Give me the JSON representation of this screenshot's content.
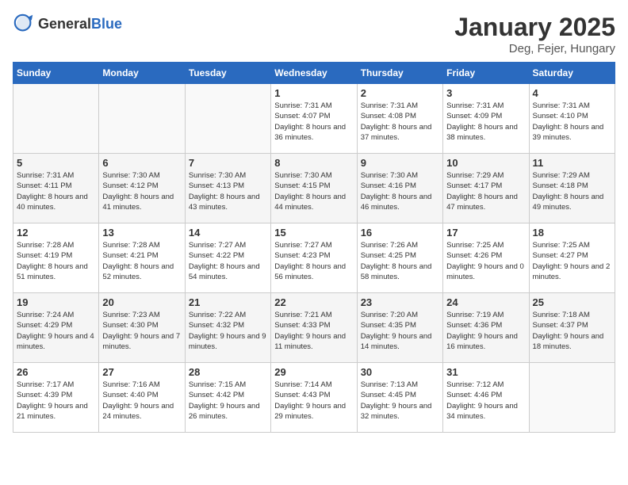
{
  "header": {
    "logo_general": "General",
    "logo_blue": "Blue",
    "month_year": "January 2025",
    "location": "Deg, Fejer, Hungary"
  },
  "days_of_week": [
    "Sunday",
    "Monday",
    "Tuesday",
    "Wednesday",
    "Thursday",
    "Friday",
    "Saturday"
  ],
  "weeks": [
    [
      {
        "day": "",
        "info": ""
      },
      {
        "day": "",
        "info": ""
      },
      {
        "day": "",
        "info": ""
      },
      {
        "day": "1",
        "info": "Sunrise: 7:31 AM\nSunset: 4:07 PM\nDaylight: 8 hours and 36 minutes."
      },
      {
        "day": "2",
        "info": "Sunrise: 7:31 AM\nSunset: 4:08 PM\nDaylight: 8 hours and 37 minutes."
      },
      {
        "day": "3",
        "info": "Sunrise: 7:31 AM\nSunset: 4:09 PM\nDaylight: 8 hours and 38 minutes."
      },
      {
        "day": "4",
        "info": "Sunrise: 7:31 AM\nSunset: 4:10 PM\nDaylight: 8 hours and 39 minutes."
      }
    ],
    [
      {
        "day": "5",
        "info": "Sunrise: 7:31 AM\nSunset: 4:11 PM\nDaylight: 8 hours and 40 minutes."
      },
      {
        "day": "6",
        "info": "Sunrise: 7:30 AM\nSunset: 4:12 PM\nDaylight: 8 hours and 41 minutes."
      },
      {
        "day": "7",
        "info": "Sunrise: 7:30 AM\nSunset: 4:13 PM\nDaylight: 8 hours and 43 minutes."
      },
      {
        "day": "8",
        "info": "Sunrise: 7:30 AM\nSunset: 4:15 PM\nDaylight: 8 hours and 44 minutes."
      },
      {
        "day": "9",
        "info": "Sunrise: 7:30 AM\nSunset: 4:16 PM\nDaylight: 8 hours and 46 minutes."
      },
      {
        "day": "10",
        "info": "Sunrise: 7:29 AM\nSunset: 4:17 PM\nDaylight: 8 hours and 47 minutes."
      },
      {
        "day": "11",
        "info": "Sunrise: 7:29 AM\nSunset: 4:18 PM\nDaylight: 8 hours and 49 minutes."
      }
    ],
    [
      {
        "day": "12",
        "info": "Sunrise: 7:28 AM\nSunset: 4:19 PM\nDaylight: 8 hours and 51 minutes."
      },
      {
        "day": "13",
        "info": "Sunrise: 7:28 AM\nSunset: 4:21 PM\nDaylight: 8 hours and 52 minutes."
      },
      {
        "day": "14",
        "info": "Sunrise: 7:27 AM\nSunset: 4:22 PM\nDaylight: 8 hours and 54 minutes."
      },
      {
        "day": "15",
        "info": "Sunrise: 7:27 AM\nSunset: 4:23 PM\nDaylight: 8 hours and 56 minutes."
      },
      {
        "day": "16",
        "info": "Sunrise: 7:26 AM\nSunset: 4:25 PM\nDaylight: 8 hours and 58 minutes."
      },
      {
        "day": "17",
        "info": "Sunrise: 7:25 AM\nSunset: 4:26 PM\nDaylight: 9 hours and 0 minutes."
      },
      {
        "day": "18",
        "info": "Sunrise: 7:25 AM\nSunset: 4:27 PM\nDaylight: 9 hours and 2 minutes."
      }
    ],
    [
      {
        "day": "19",
        "info": "Sunrise: 7:24 AM\nSunset: 4:29 PM\nDaylight: 9 hours and 4 minutes."
      },
      {
        "day": "20",
        "info": "Sunrise: 7:23 AM\nSunset: 4:30 PM\nDaylight: 9 hours and 7 minutes."
      },
      {
        "day": "21",
        "info": "Sunrise: 7:22 AM\nSunset: 4:32 PM\nDaylight: 9 hours and 9 minutes."
      },
      {
        "day": "22",
        "info": "Sunrise: 7:21 AM\nSunset: 4:33 PM\nDaylight: 9 hours and 11 minutes."
      },
      {
        "day": "23",
        "info": "Sunrise: 7:20 AM\nSunset: 4:35 PM\nDaylight: 9 hours and 14 minutes."
      },
      {
        "day": "24",
        "info": "Sunrise: 7:19 AM\nSunset: 4:36 PM\nDaylight: 9 hours and 16 minutes."
      },
      {
        "day": "25",
        "info": "Sunrise: 7:18 AM\nSunset: 4:37 PM\nDaylight: 9 hours and 18 minutes."
      }
    ],
    [
      {
        "day": "26",
        "info": "Sunrise: 7:17 AM\nSunset: 4:39 PM\nDaylight: 9 hours and 21 minutes."
      },
      {
        "day": "27",
        "info": "Sunrise: 7:16 AM\nSunset: 4:40 PM\nDaylight: 9 hours and 24 minutes."
      },
      {
        "day": "28",
        "info": "Sunrise: 7:15 AM\nSunset: 4:42 PM\nDaylight: 9 hours and 26 minutes."
      },
      {
        "day": "29",
        "info": "Sunrise: 7:14 AM\nSunset: 4:43 PM\nDaylight: 9 hours and 29 minutes."
      },
      {
        "day": "30",
        "info": "Sunrise: 7:13 AM\nSunset: 4:45 PM\nDaylight: 9 hours and 32 minutes."
      },
      {
        "day": "31",
        "info": "Sunrise: 7:12 AM\nSunset: 4:46 PM\nDaylight: 9 hours and 34 minutes."
      },
      {
        "day": "",
        "info": ""
      }
    ]
  ]
}
